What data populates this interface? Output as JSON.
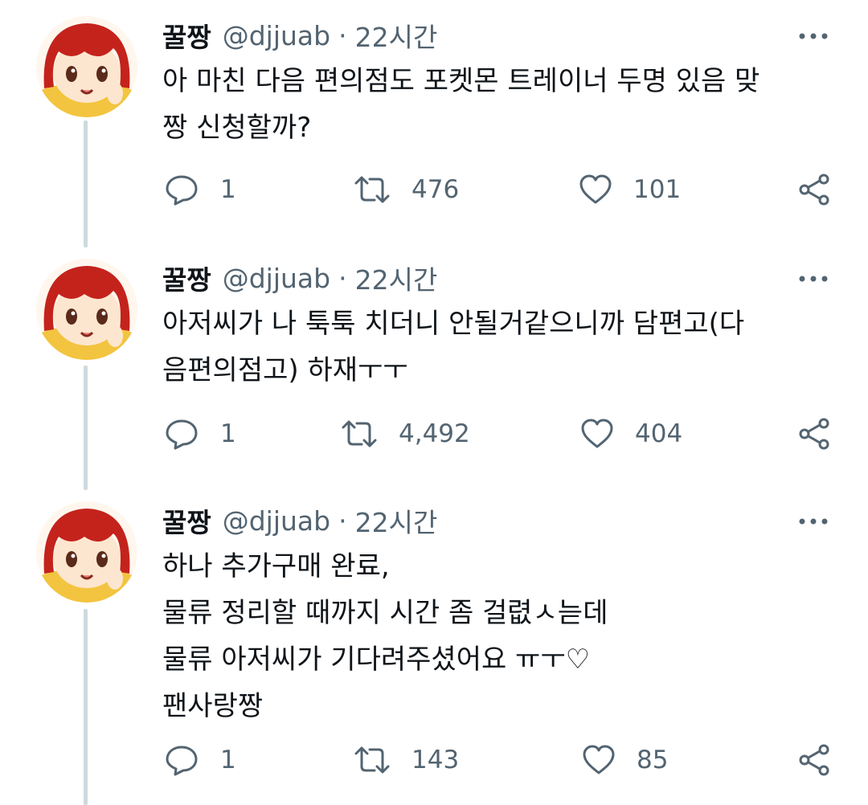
{
  "tweets": [
    {
      "display_name": "꿀짱",
      "handle": "@djjuab",
      "separator": "·",
      "time": "22시간",
      "text": "아 마친 다음 편의점도 포켓몬 트레이너 두명 있음 맞\n짱 신청할까?",
      "replies": "1",
      "retweets": "476",
      "likes": "101"
    },
    {
      "display_name": "꿀짱",
      "handle": "@djjuab",
      "separator": "·",
      "time": "22시간",
      "text": "아저씨가 나 툭툭 치더니 안될거같으니까 담편고(다\n음편의점고) 하재ㅜㅜ",
      "replies": "1",
      "retweets": "4,492",
      "likes": "404"
    },
    {
      "display_name": "꿀짱",
      "handle": "@djjuab",
      "separator": "·",
      "time": "22시간",
      "text": "하나 추가구매 완료,\n물류 정리할 때까지 시간 좀 걸렶ㅅ늗데\n물류 아저씨가 기다려주셨어요 ㅠㅜ♡\n팬사랑짱",
      "replies": "1",
      "retweets": "143",
      "likes": "85"
    }
  ],
  "icons": {
    "reply": "reply-icon",
    "retweet": "retweet-icon",
    "like": "heart-icon",
    "share": "share-icon",
    "more": "more-icon"
  },
  "colors": {
    "text": "#0f1419",
    "secondary": "#536471",
    "thread_line": "#cfd9de",
    "avatar_hair": "#c4231c",
    "avatar_skin": "#fde6cf",
    "avatar_sweater": "#f3c43f"
  }
}
